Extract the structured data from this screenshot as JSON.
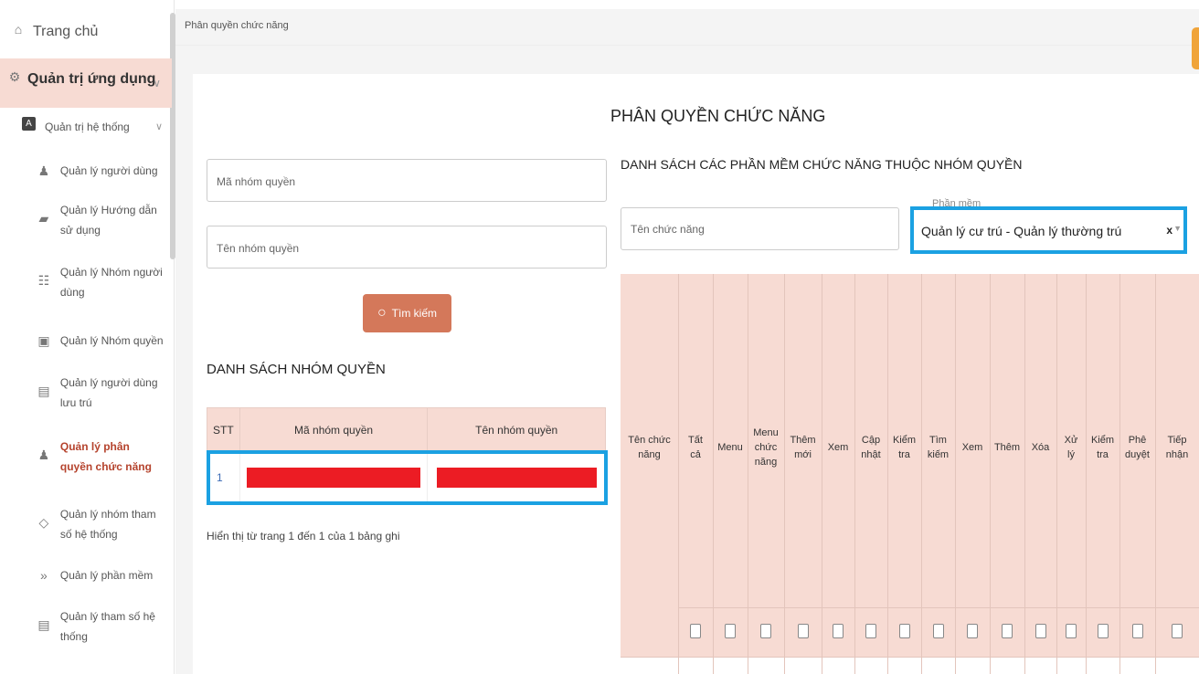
{
  "sidebar": {
    "home": "Trang chủ",
    "admin": "Quản trị ứng dụng",
    "system": "Quản trị hệ thống",
    "items": [
      {
        "label": "Quản lý người dùng",
        "icon": "user-icon"
      },
      {
        "label": "Quản lý Hướng dẫn sử dụng",
        "icon": "book-icon"
      },
      {
        "label": "Quản lý Nhóm người dùng",
        "icon": "users-icon"
      },
      {
        "label": "Quản lý Nhóm quyền",
        "icon": "id-card-icon"
      },
      {
        "label": "Quản lý người dùng lưu trú",
        "icon": "document-icon"
      },
      {
        "label": "Quản lý phân quyền chức năng",
        "icon": "user-icon"
      },
      {
        "label": "Quản lý nhóm tham số hệ thống",
        "icon": "diamond-icon"
      },
      {
        "label": "Quản lý phần mềm",
        "icon": "chevrons-right-icon"
      },
      {
        "label": "Quản lý tham số hệ thống",
        "icon": "list-icon"
      }
    ]
  },
  "breadcrumb": "Phân quyền chức năng",
  "page_title": "PHÂN QUYỀN CHỨC NĂNG",
  "search": {
    "ma_placeholder": "Mã nhóm quyền",
    "ten_placeholder": "Tên nhóm quyền",
    "button": "Tìm kiếm"
  },
  "group_list": {
    "title": "DANH SÁCH NHÓM QUYỀN",
    "headers": [
      "STT",
      "Mã nhóm quyền",
      "Tên nhóm quyền"
    ],
    "rows": [
      {
        "stt": "1"
      }
    ],
    "pager": "Hiển thị từ trang 1 đến 1 của 1 bảng ghi"
  },
  "function_list": {
    "title": "DANH SÁCH CÁC PHẦN MỀM CHỨC NĂNG THUỘC NHÓM QUYỀN",
    "name_placeholder": "Tên chức năng",
    "software_label": "Phần mềm",
    "software_value": "Quản lý cư trú - Quản lý thường trú",
    "clear": "x",
    "headers": [
      "Tên chức năng",
      "Tất cả",
      "Menu",
      "Menu chức năng",
      "Thêm mới",
      "Xem",
      "Cập nhật",
      "Kiểm tra",
      "Tìm kiếm",
      "Xem",
      "Thêm",
      "Xóa",
      "Xử lý",
      "Kiểm tra",
      "Phê duyệt",
      "Tiếp nhận"
    ]
  },
  "colors": {
    "accent": "#d4785a",
    "header_bg": "#f7dbd3",
    "highlight": "#1ba1e2",
    "redaction": "#ec1c24"
  }
}
